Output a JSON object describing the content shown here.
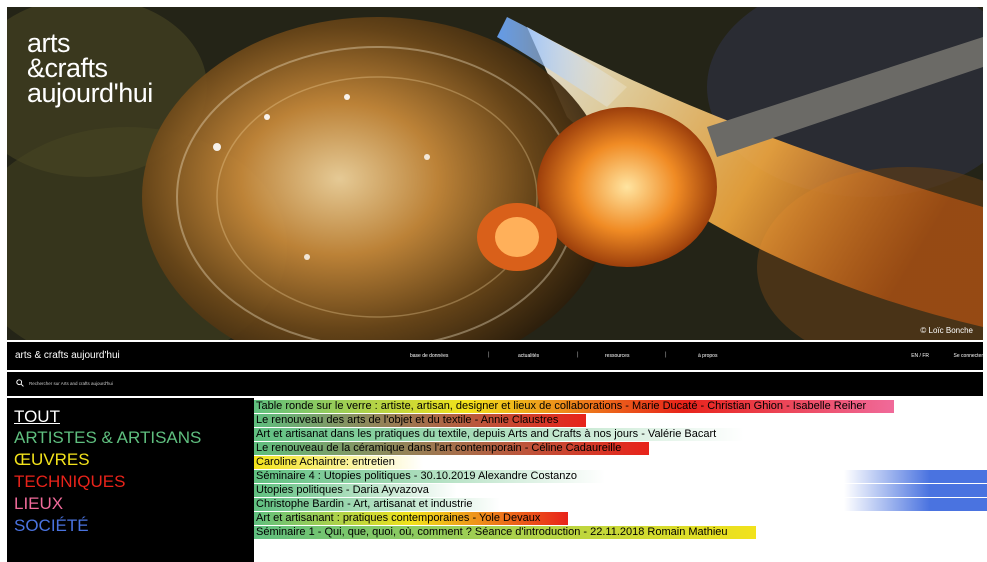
{
  "hero": {
    "logo_lines": [
      "arts",
      "&crafts",
      "aujourd'hui"
    ],
    "credit": "© Loïc Bonche"
  },
  "topbar": {
    "site_title": "arts & crafts aujourd'hui",
    "nav": [
      "base de données",
      "actualités",
      "ressources",
      "à propos"
    ],
    "lang": "EN / FR",
    "connect": "Se connecter"
  },
  "search": {
    "placeholder": "Rechercher sur Arts and crafts aujourd'hui"
  },
  "menu": [
    {
      "label": "TOUT",
      "color": "#ffffff"
    },
    {
      "label": "ARTISTES & ARTISANS",
      "color": "#5fbf7f"
    },
    {
      "label": "ŒUVRES",
      "color": "#f2e21b"
    },
    {
      "label": "TECHNIQUES",
      "color": "#e8231a"
    },
    {
      "label": "LIEUX",
      "color": "#f06a9a"
    },
    {
      "label": "SOCIÉTÉ",
      "color": "#4a73e0"
    }
  ],
  "rows": [
    {
      "text": "Table ronde sur le verre : artiste, artisan, designer et lieux de collaborations - Marie Ducaté - Christian Ghion - Isabelle Reiher",
      "colors": [
        "#5fbf7f",
        "#f2e21b",
        "#e8231a",
        "#f06a9a"
      ]
    },
    {
      "text": "Le renouveau des arts de l'objet et du textile - Annie Claustres",
      "colors": [
        "#5fbf7f",
        "#e8231a"
      ]
    },
    {
      "text": "Art et artisanat dans les pratiques du textile, depuis Arts and Crafts à nos jours - Valérie Bacart",
      "colors": [
        "#5fbf7f",
        "#ffffff"
      ]
    },
    {
      "text": "Le renouveau de la céramique dans l'art contemporain - Céline Cadaureille",
      "colors": [
        "#5fbf7f",
        "#e8231a"
      ]
    },
    {
      "text": "Caroline Achaintre: entretien",
      "colors": [
        "#f2e21b",
        "#ffffff"
      ]
    },
    {
      "text": "Séminaire 4 : Utopies politiques - 30.10.2019 Alexandre Costanzo",
      "colors": [
        "#5fbf7f",
        "#ffffff"
      ],
      "accent": "#4a73e0"
    },
    {
      "text": "Utopies politiques - Daria Ayvazova",
      "colors": [
        "#5fbf7f",
        "#ffffff"
      ],
      "accent": "#4a73e0"
    },
    {
      "text": "Christophe Bardin - Art, artisanat et industrie",
      "colors": [
        "#5fbf7f",
        "#ffffff"
      ],
      "accent": "#4a73e0"
    },
    {
      "text": "Art et artisanant : pratiques contemporaines - Yole Devaux",
      "colors": [
        "#5fbf7f",
        "#f2e21b",
        "#e8231a"
      ]
    },
    {
      "text": "Séminaire 1 - Qui, que, quoi, où, comment ? Séance d'introduction - 22.11.2018 Romain Mathieu",
      "colors": [
        "#5fbf7f",
        "#f2e21b"
      ]
    }
  ]
}
